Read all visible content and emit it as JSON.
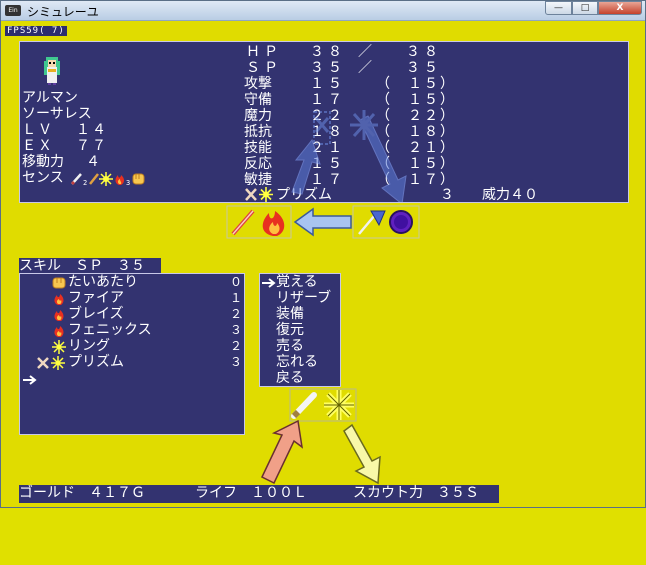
{
  "window": {
    "title": "シミュレーユ",
    "min": "—",
    "max": "□",
    "close": "X"
  },
  "fps": "FPS59( 7)",
  "character": {
    "name": "アルマン",
    "class": "ソーサレス",
    "lv_label": "ＬＶ",
    "lv_value": "１４",
    "ex_label": "ＥＸ",
    "ex_value": "７７",
    "move_label": "移動力",
    "move_value": "４",
    "sense_label": "センス"
  },
  "stats": {
    "hp": {
      "label": "ＨＰ",
      "cur": "３８",
      "sep": "／",
      "max": "３８"
    },
    "sp": {
      "label": "ＳＰ",
      "cur": "３５",
      "sep": "／",
      "max": "３５"
    },
    "rows": [
      {
        "label": "攻撃",
        "value": "１５",
        "base": "（　１５）"
      },
      {
        "label": "守備",
        "value": "１７",
        "base": "（　１５）"
      },
      {
        "label": "魔力",
        "value": "２２",
        "base": "（　２２）"
      },
      {
        "label": "抵抗",
        "value": "１８",
        "base": "（　１８）"
      },
      {
        "label": "技能",
        "value": "２１",
        "base": "（　２１）"
      },
      {
        "label": "反応",
        "value": "１５",
        "base": "（　１５）"
      },
      {
        "label": "敏捷",
        "value": "１７",
        "base": "（　１７）"
      }
    ],
    "equip_name": "プリズム",
    "equip_count": "３",
    "equip_power": "威力４０"
  },
  "skills": {
    "header": "スキル　ＳＰ　３５",
    "items": [
      {
        "name": "たいあたり",
        "cost": "０"
      },
      {
        "name": "ファイア",
        "cost": "１"
      },
      {
        "name": "ブレイズ",
        "cost": "２"
      },
      {
        "name": "フェニックス",
        "cost": "３"
      },
      {
        "name": "リング",
        "cost": "２"
      },
      {
        "name": "プリズム",
        "cost": "３"
      }
    ]
  },
  "menu": {
    "items": [
      "覚える",
      "リザーブ",
      "装備",
      "復元",
      "売る",
      "忘れる",
      "戻る"
    ]
  },
  "status_bar": {
    "gold": "ゴールド　４１７Ｇ",
    "life": "ライフ　１００Ｌ",
    "scout": "スカウト力　３５Ｓ"
  },
  "colors": {
    "background": "#e0dc00",
    "panel": "#333370",
    "arrow_blue": "#8aaad8",
    "arrow_red": "#f0a088"
  }
}
